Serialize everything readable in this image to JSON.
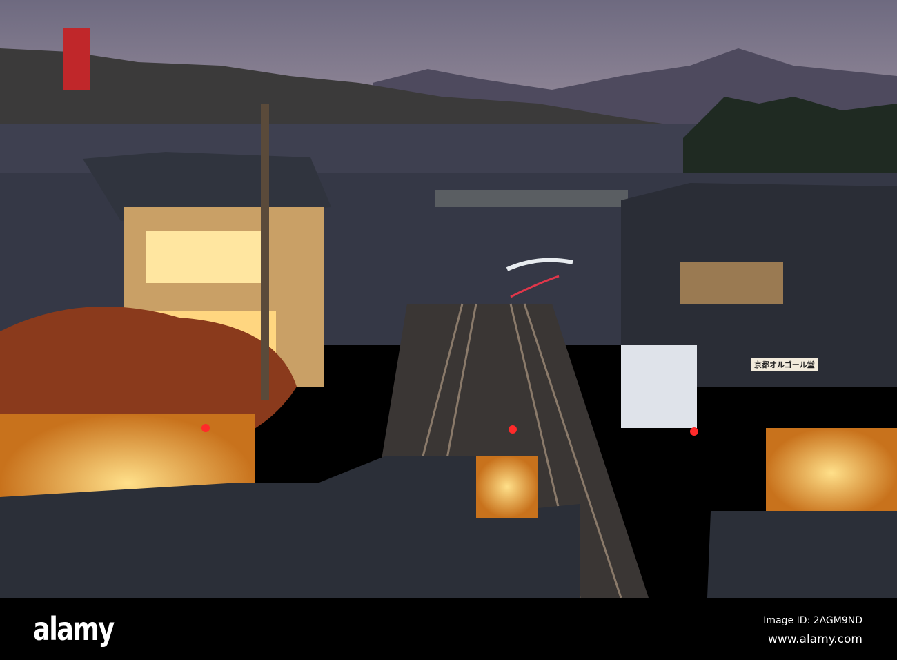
{
  "photo": {
    "subject": "Kyoto railway crossing at dusk",
    "shop_sign": "京都オルゴール堂"
  },
  "watermark": {
    "logo": "alamy",
    "image_id": "Image ID: 2AGM9ND",
    "url": "www.alamy.com"
  },
  "colors": {
    "sky": "#7d7890",
    "mountain": "#4a4658",
    "roof": "#2c3038",
    "lamp": "#f6c14a"
  }
}
